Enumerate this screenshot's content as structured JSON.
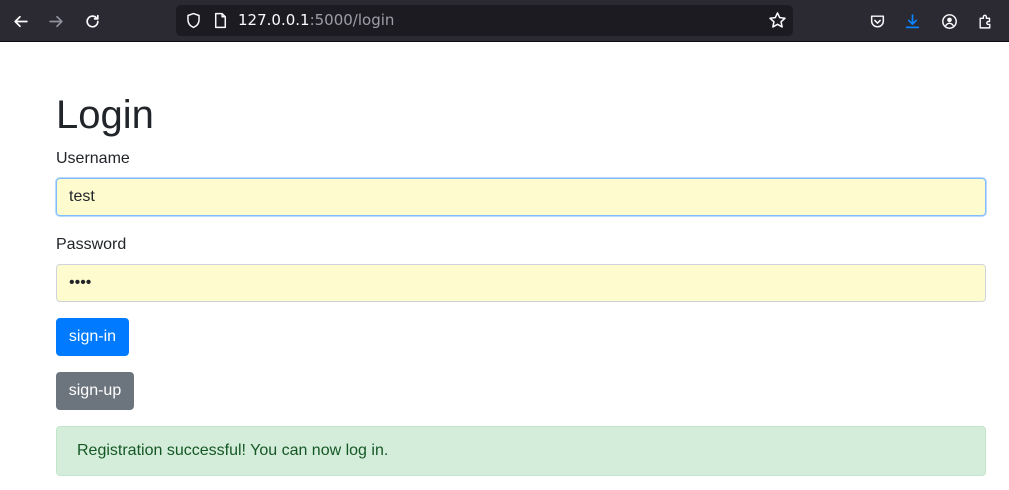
{
  "browser": {
    "url_host": "127.0.0.1",
    "url_path": ":5000/login",
    "icons": [
      "back-arrow-icon",
      "forward-arrow-icon",
      "reload-icon",
      "shield-icon",
      "page-icon",
      "bookmark-star-icon",
      "pocket-icon",
      "download-icon",
      "account-icon",
      "extensions-icon"
    ],
    "download_icon_color": "#0a84ff"
  },
  "page": {
    "title": "Login",
    "username": {
      "label": "Username",
      "value": "test"
    },
    "password": {
      "label": "Password",
      "value": "test"
    },
    "signin_label": "sign-in",
    "signup_label": "sign-up",
    "alert_message": "Registration successful! You can now log in."
  },
  "colors": {
    "primary": "#007bff",
    "secondary": "#6c757d",
    "autofill_bg": "#fefccf",
    "alert_success_bg": "#d4edda",
    "alert_success_text": "#155724"
  }
}
